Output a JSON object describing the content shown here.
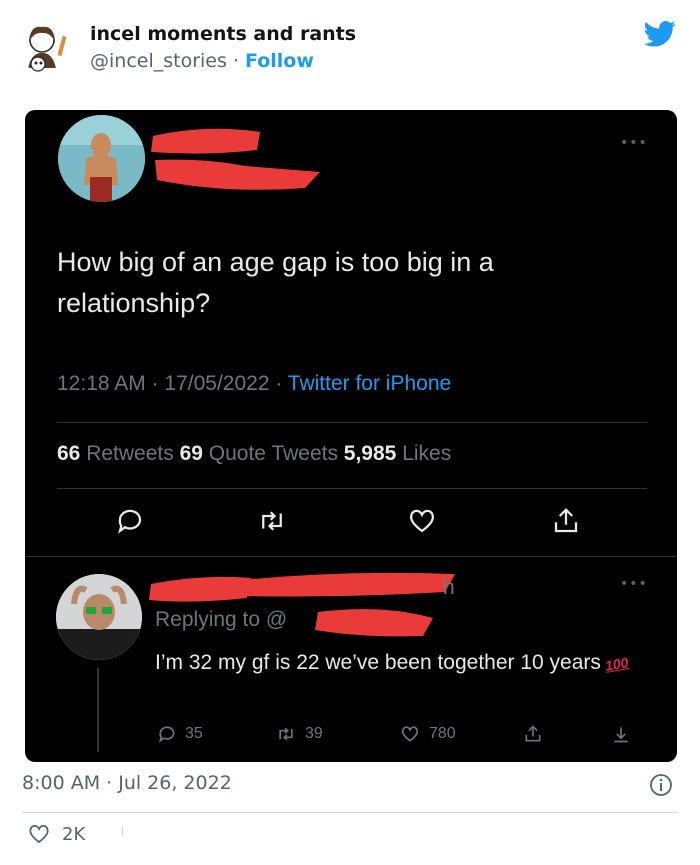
{
  "embed": {
    "account_name": "incel moments and rants",
    "handle": "@incel_stories",
    "separator": " · ",
    "follow_label": "Follow",
    "timestamp": "8:00 AM · Jul 26, 2022",
    "like_count": "2K",
    "brand_color": "#1d9bf0"
  },
  "screenshot": {
    "tweet": {
      "text": "How big of an age gap is too big in a relationship?",
      "time": "12:18 AM · 17/05/2022 · ",
      "source": "Twitter for iPhone",
      "retweets": "66",
      "retweets_label": " Retweets ",
      "quote_tweets": "69",
      "quote_tweets_label": " Quote Tweets ",
      "likes": "5,985",
      "likes_label": " Likes",
      "more": "•••"
    },
    "reply": {
      "time_suffix": "h",
      "replying_to": "Replying to @",
      "text": "I’m 32 my gf is 22 we’ve been together 10 years",
      "emoji": "100",
      "replies": "35",
      "retweets": "39",
      "likes": "780",
      "more": "•••"
    }
  }
}
